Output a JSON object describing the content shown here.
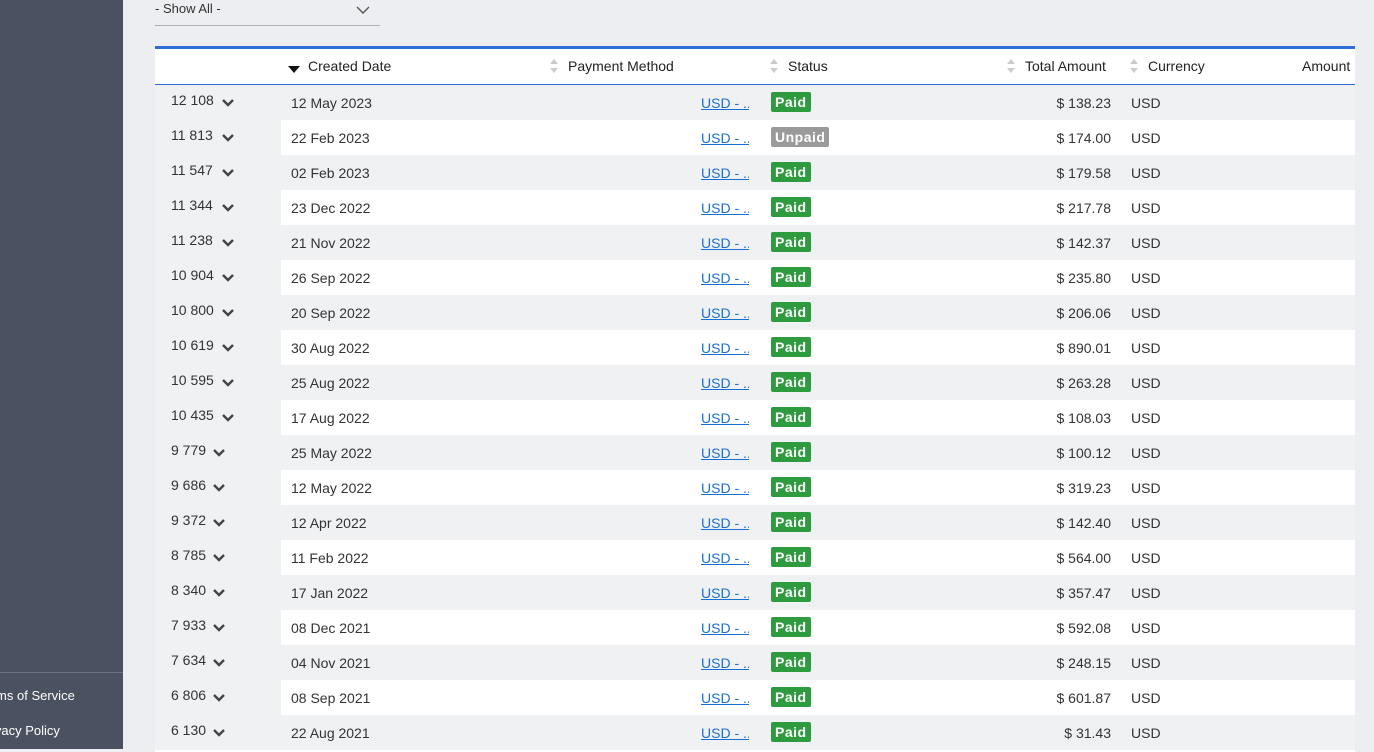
{
  "sidebar": {
    "links": [
      {
        "label": "Terms of Service"
      },
      {
        "label": "Privacy Policy"
      }
    ]
  },
  "filter": {
    "value": "- Show All -"
  },
  "table": {
    "columns": [
      "",
      "Created Date",
      "Payment Method",
      "Status",
      "Total Amount",
      "Currency",
      "Amount"
    ],
    "rows": [
      {
        "id": "12 108",
        "date": "12 May 2023",
        "method": "USD - ...",
        "status": "Paid",
        "total": "$ 138.23",
        "currency": "USD"
      },
      {
        "id": "11 813",
        "date": "22 Feb 2023",
        "method": "USD - ...",
        "status": "Unpaid",
        "total": "$ 174.00",
        "currency": "USD"
      },
      {
        "id": "11 547",
        "date": "02 Feb 2023",
        "method": "USD - ...",
        "status": "Paid",
        "total": "$ 179.58",
        "currency": "USD"
      },
      {
        "id": "11 344",
        "date": "23 Dec 2022",
        "method": "USD - ...",
        "status": "Paid",
        "total": "$ 217.78",
        "currency": "USD"
      },
      {
        "id": "11 238",
        "date": "21 Nov 2022",
        "method": "USD - ...",
        "status": "Paid",
        "total": "$ 142.37",
        "currency": "USD"
      },
      {
        "id": "10 904",
        "date": "26 Sep 2022",
        "method": "USD - ...",
        "status": "Paid",
        "total": "$ 235.80",
        "currency": "USD"
      },
      {
        "id": "10 800",
        "date": "20 Sep 2022",
        "method": "USD - ...",
        "status": "Paid",
        "total": "$ 206.06",
        "currency": "USD"
      },
      {
        "id": "10 619",
        "date": "30 Aug 2022",
        "method": "USD - ...",
        "status": "Paid",
        "total": "$ 890.01",
        "currency": "USD"
      },
      {
        "id": "10 595",
        "date": "25 Aug 2022",
        "method": "USD - ...",
        "status": "Paid",
        "total": "$ 263.28",
        "currency": "USD"
      },
      {
        "id": "10 435",
        "date": "17 Aug 2022",
        "method": "USD - ...",
        "status": "Paid",
        "total": "$ 108.03",
        "currency": "USD"
      },
      {
        "id": "9 779",
        "date": "25 May 2022",
        "method": "USD - ...",
        "status": "Paid",
        "total": "$ 100.12",
        "currency": "USD"
      },
      {
        "id": "9 686",
        "date": "12 May 2022",
        "method": "USD - ...",
        "status": "Paid",
        "total": "$ 319.23",
        "currency": "USD"
      },
      {
        "id": "9 372",
        "date": "12 Apr 2022",
        "method": "USD - ...",
        "status": "Paid",
        "total": "$ 142.40",
        "currency": "USD"
      },
      {
        "id": "8 785",
        "date": "11 Feb 2022",
        "method": "USD - ...",
        "status": "Paid",
        "total": "$ 564.00",
        "currency": "USD"
      },
      {
        "id": "8 340",
        "date": "17 Jan 2022",
        "method": "USD - ...",
        "status": "Paid",
        "total": "$ 357.47",
        "currency": "USD"
      },
      {
        "id": "7 933",
        "date": "08 Dec 2021",
        "method": "USD - ...",
        "status": "Paid",
        "total": "$ 592.08",
        "currency": "USD"
      },
      {
        "id": "7 634",
        "date": "04 Nov 2021",
        "method": "USD - ...",
        "status": "Paid",
        "total": "$ 248.15",
        "currency": "USD"
      },
      {
        "id": "6 806",
        "date": "08 Sep 2021",
        "method": "USD - ...",
        "status": "Paid",
        "total": "$ 601.87",
        "currency": "USD"
      },
      {
        "id": "6 130",
        "date": "22 Aug 2021",
        "method": "USD - ...",
        "status": "Paid",
        "total": "$ 31.43",
        "currency": "USD"
      }
    ]
  },
  "colors": {
    "sidebar": "#4a5160",
    "accent": "#2c6ed5",
    "paid": "#2e9b3e",
    "unpaid": "#9a9a9a",
    "link": "#1a6fd6"
  },
  "icons": {
    "filter": "chevron-down-icon",
    "sort_desc": "sort-desc-icon",
    "sort": "sort-icon",
    "expand": "chevron-down-icon"
  }
}
